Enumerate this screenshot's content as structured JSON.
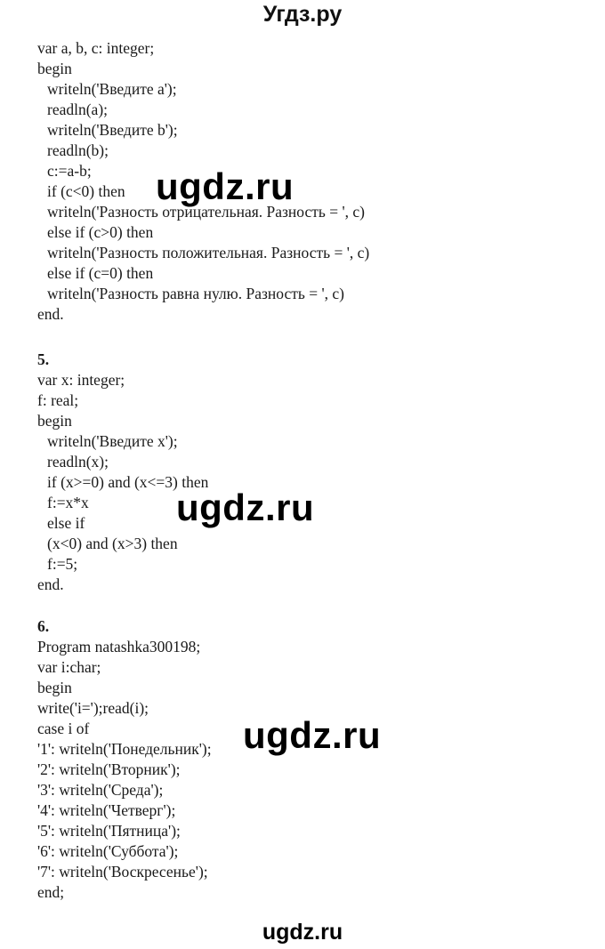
{
  "header": {
    "title": "Угдз.ру"
  },
  "sections": [
    {
      "number": "",
      "lines": [
        {
          "text": "var a, b, c: integer;",
          "indent": false
        },
        {
          "text": "begin",
          "indent": false
        },
        {
          "text": "writeln('Введите a');",
          "indent": true
        },
        {
          "text": "readln(a);",
          "indent": true
        },
        {
          "text": "writeln('Введите b');",
          "indent": true
        },
        {
          "text": "readln(b);",
          "indent": true
        },
        {
          "text": "c:=a-b;",
          "indent": true
        },
        {
          "text": "if (c<0) then",
          "indent": true
        },
        {
          "text": "writeln('Разность отрицательная. Разность = ', c)",
          "indent": true
        },
        {
          "text": "else if (c>0) then",
          "indent": true
        },
        {
          "text": "writeln('Разность положительная. Разность = ', c)",
          "indent": true
        },
        {
          "text": "else if (c=0) then",
          "indent": true
        },
        {
          "text": "writeln('Разность равна нулю. Разность = ', c)",
          "indent": true
        },
        {
          "text": "end.",
          "indent": false
        }
      ]
    },
    {
      "number": "5.",
      "lines": [
        {
          "text": "var x: integer;",
          "indent": false
        },
        {
          "text": "f: real;",
          "indent": false
        },
        {
          "text": "begin",
          "indent": false
        },
        {
          "text": "writeln('Введите x');",
          "indent": true
        },
        {
          "text": "readln(x);",
          "indent": true
        },
        {
          "text": "if (x>=0) and (x<=3) then",
          "indent": true
        },
        {
          "text": "f:=x*x",
          "indent": true
        },
        {
          "text": "else if",
          "indent": true
        },
        {
          "text": "(x<0) and (x>3) then",
          "indent": true
        },
        {
          "text": "f:=5;",
          "indent": true
        },
        {
          "text": "end.",
          "indent": false
        }
      ]
    },
    {
      "number": "6.",
      "lines": [
        {
          "text": "Program natashka300198;",
          "indent": false
        },
        {
          "text": "var i:char;",
          "indent": false
        },
        {
          "text": "begin",
          "indent": false
        },
        {
          "text": "write('i=');read(i);",
          "indent": false
        },
        {
          "text": "case i of",
          "indent": false
        },
        {
          "text": "'1': writeln('Понедельник');",
          "indent": false
        },
        {
          "text": "'2': writeln('Вторник');",
          "indent": false
        },
        {
          "text": "'3': writeln('Среда');",
          "indent": false
        },
        {
          "text": "'4': writeln('Четверг');",
          "indent": false
        },
        {
          "text": "'5': writeln('Пятница');",
          "indent": false
        },
        {
          "text": "'6': writeln('Суббота');",
          "indent": false
        },
        {
          "text": "'7': writeln('Воскресенье');",
          "indent": false
        },
        {
          "text": "end;",
          "indent": false
        }
      ]
    }
  ],
  "watermarks": [
    "ugdz.ru",
    "ugdz.ru",
    "ugdz.ru"
  ],
  "footer": {
    "text": "ugdz.ru"
  }
}
